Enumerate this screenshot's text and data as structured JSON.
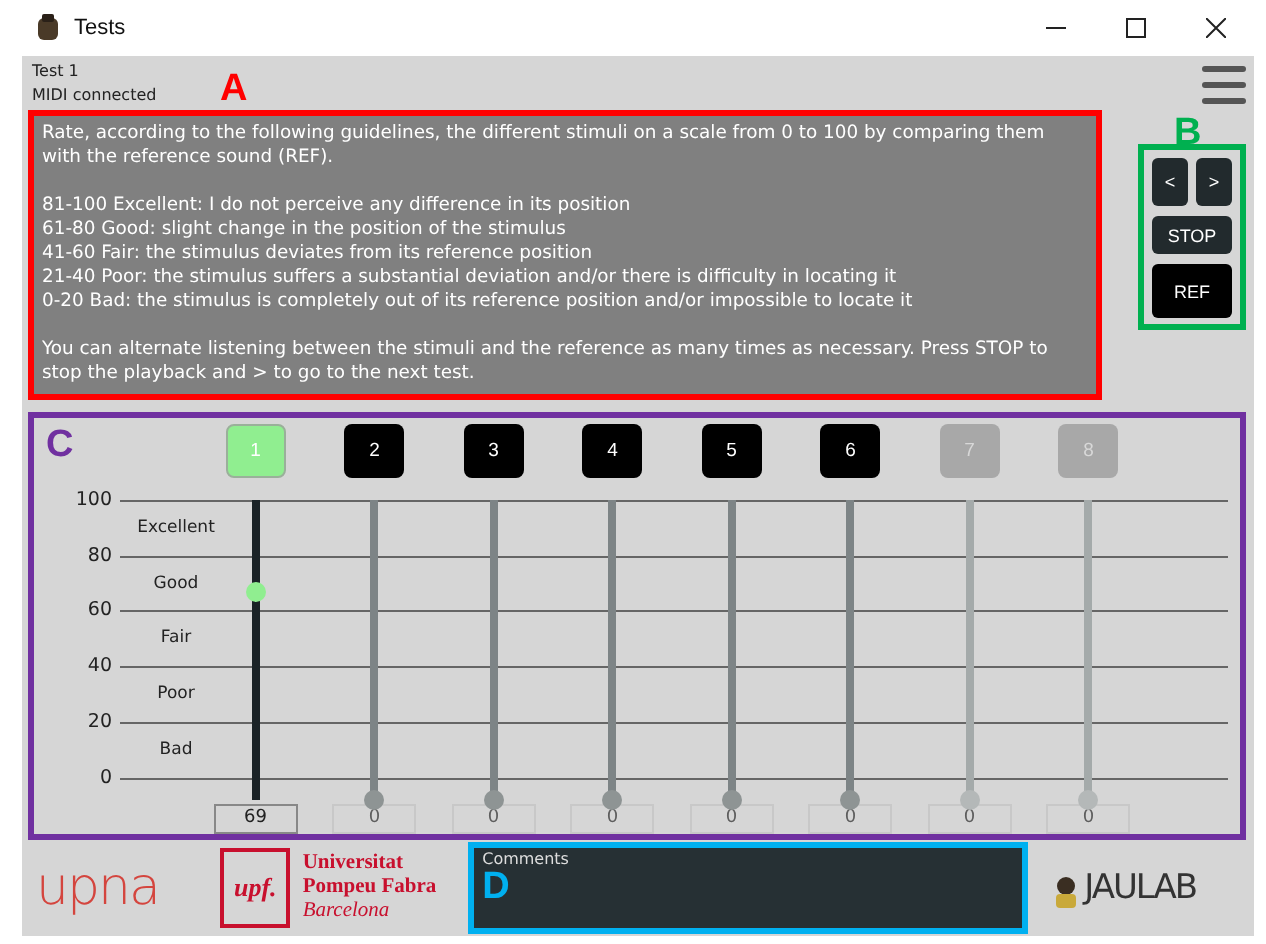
{
  "window": {
    "title": "Tests"
  },
  "test_label": "Test 1",
  "midi_status": "MIDI connected",
  "annotations": [
    {
      "label": "A",
      "color": "#ff0000"
    },
    {
      "label": "B",
      "color": "#00b050"
    },
    {
      "label": "C",
      "color": "#7030a0"
    },
    {
      "label": "D",
      "color": "#00b0f0"
    }
  ],
  "instructions": {
    "intro": "Rate, according to the following guidelines, the different stimuli on a scale from 0 to 100 by comparing them with the reference sound (REF).",
    "guidelines": [
      " 81-100 Excellent: I do not perceive any difference in its position",
      " 61-80 Good: slight change in the position of the stimulus",
      " 41-60 Fair: the stimulus deviates from its reference position",
      " 21-40 Poor: the stimulus suffers a substantial deviation and/or there is difficulty in locating it",
      " 0-20 Bad: the stimulus is completely out of its reference position and/or impossible to locate it"
    ],
    "outro": "You can alternate listening between the stimuli and the reference as many times as necessary. Press STOP to stop the playback and > to go to the next test."
  },
  "controls": {
    "prev": "<",
    "next": ">",
    "stop": "STOP",
    "ref": "REF"
  },
  "scale": {
    "ticks": [
      "100",
      "80",
      "60",
      "40",
      "20",
      "0"
    ],
    "categories": [
      "Excellent",
      "Good",
      "Fair",
      "Poor",
      "Bad"
    ]
  },
  "stimuli": [
    {
      "label": "1",
      "selected": true,
      "disabled": false,
      "level": 0.69,
      "value": "69"
    },
    {
      "label": "2",
      "selected": false,
      "disabled": false,
      "level": 0,
      "value": "0"
    },
    {
      "label": "3",
      "selected": false,
      "disabled": false,
      "level": 0,
      "value": "0"
    },
    {
      "label": "4",
      "selected": false,
      "disabled": false,
      "level": 0,
      "value": "0"
    },
    {
      "label": "5",
      "selected": false,
      "disabled": false,
      "level": 0,
      "value": "0"
    },
    {
      "label": "6",
      "selected": false,
      "disabled": false,
      "level": 0,
      "value": "0"
    },
    {
      "label": "7",
      "selected": false,
      "disabled": true,
      "level": 0,
      "value": "0"
    },
    {
      "label": "8",
      "selected": false,
      "disabled": true,
      "level": 0,
      "value": "0"
    }
  ],
  "comments": {
    "label": "Comments"
  },
  "logos": {
    "upna": "upna",
    "upf_mark": "upf.",
    "upf_name": [
      "Universitat",
      "Pompeu Fabra",
      "Barcelona"
    ],
    "jaulab": "JAULAB"
  }
}
